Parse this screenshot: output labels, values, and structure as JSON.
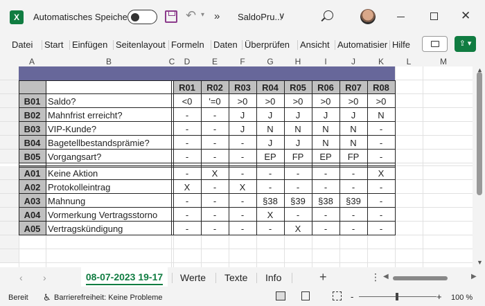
{
  "titlebar": {
    "logo": "X",
    "autosave_label": "Automatisches Speichern",
    "more": "»",
    "filename": "SaldoPru...",
    "filename_caret": "∨",
    "close": "✕"
  },
  "ribbon": {
    "tabs": [
      "Datei",
      "Start",
      "Einfügen",
      "Seitenlayout",
      "Formeln",
      "Daten",
      "Überprüfen",
      "Ansicht",
      "Automatisier",
      "Hilfe"
    ]
  },
  "columns": [
    "A",
    "B",
    "C",
    "D",
    "E",
    "F",
    "G",
    "H",
    "I",
    "J",
    "K",
    "L",
    "M"
  ],
  "rows": [
    "1",
    "2",
    "3",
    "4",
    "5",
    "6",
    "7",
    "",
    "9",
    "10",
    "11",
    "12",
    "13",
    "14",
    "15"
  ],
  "table": {
    "rule_headers": [
      "R01",
      "R02",
      "R03",
      "R04",
      "R05",
      "R06",
      "R07",
      "R08"
    ],
    "conditions": [
      {
        "id": "B01",
        "label": "Saldo?",
        "values": [
          "<0",
          "'=0",
          ">0",
          ">0",
          ">0",
          ">0",
          ">0",
          ">0"
        ]
      },
      {
        "id": "B02",
        "label": "Mahnfrist erreicht?",
        "values": [
          "-",
          "-",
          "J",
          "J",
          "J",
          "J",
          "J",
          "N"
        ]
      },
      {
        "id": "B03",
        "label": "VIP-Kunde?",
        "values": [
          "-",
          "-",
          "J",
          "N",
          "N",
          "N",
          "N",
          "-"
        ]
      },
      {
        "id": "B04",
        "label": "Bagetellbestandsprämie?",
        "values": [
          "-",
          "-",
          "-",
          "J",
          "J",
          "N",
          "N",
          "-"
        ]
      },
      {
        "id": "B05",
        "label": "Vorgangsart?",
        "values": [
          "-",
          "-",
          "-",
          "EP",
          "FP",
          "EP",
          "FP",
          "-"
        ]
      }
    ],
    "actions": [
      {
        "id": "A01",
        "label": "Keine Aktion",
        "values": [
          "-",
          "X",
          "-",
          "-",
          "-",
          "-",
          "-",
          "X"
        ]
      },
      {
        "id": "A02",
        "label": "Protokolleintrag",
        "values": [
          "X",
          "-",
          "X",
          "-",
          "-",
          "-",
          "-",
          "-"
        ]
      },
      {
        "id": "A03",
        "label": "Mahnung",
        "values": [
          "-",
          "-",
          "-",
          "§38",
          "§39",
          "§38",
          "§39",
          "-"
        ]
      },
      {
        "id": "A04",
        "label": "Vormerkung Vertragsstorno",
        "values": [
          "-",
          "-",
          "-",
          "X",
          "-",
          "-",
          "-",
          "-"
        ]
      },
      {
        "id": "A05",
        "label": "Vertragskündigung",
        "values": [
          "-",
          "-",
          "-",
          "-",
          "X",
          "-",
          "-",
          "-"
        ]
      }
    ]
  },
  "sheets": {
    "active": "08-07-2023 19-17",
    "others": [
      "Werte",
      "Texte",
      "Info"
    ],
    "add": "+"
  },
  "status": {
    "ready": "Bereit",
    "accessibility": "Barrierefreiheit: Keine Probleme",
    "zoom": "100 %",
    "zoom_minus": "-",
    "zoom_plus": "+"
  },
  "colors": {
    "header_fill": "#67679a",
    "gray_fill": "#c0c0c0",
    "excel_green": "#107c41"
  }
}
